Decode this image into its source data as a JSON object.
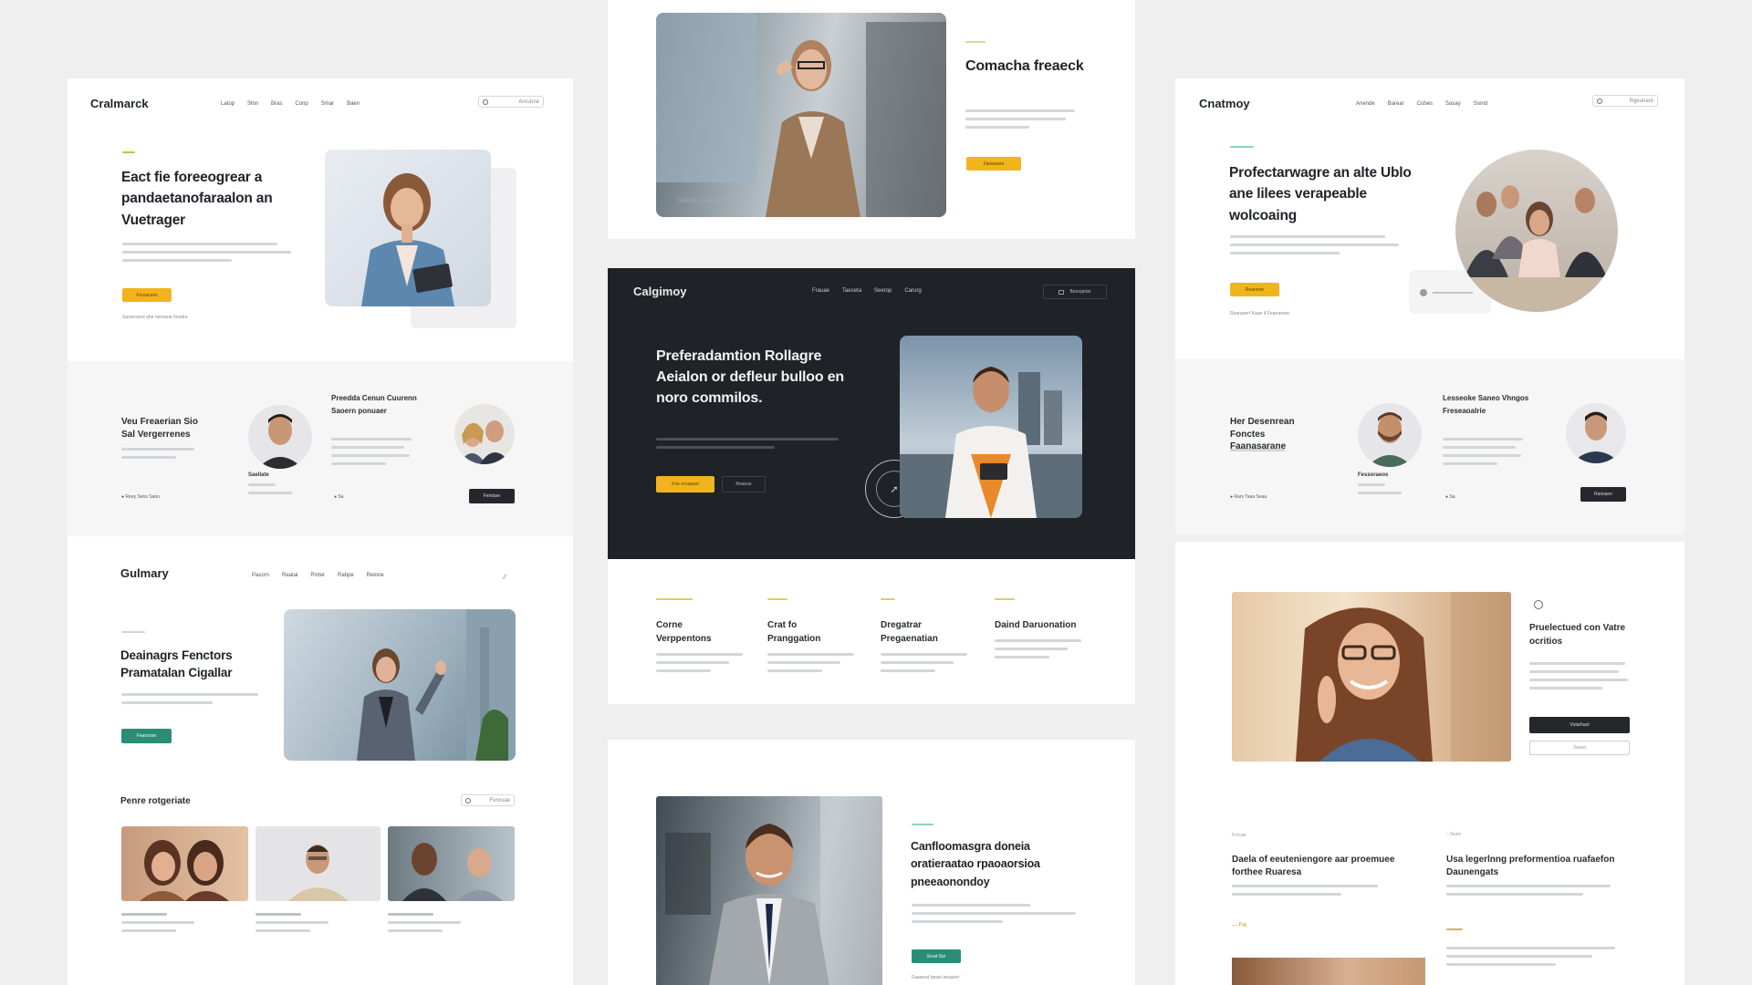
{
  "c1": {
    "logo": "Cralmarck",
    "nav": [
      "Latop",
      "Shin",
      "Bras",
      "Conp",
      "Smar",
      "Baen"
    ],
    "search": "Anrunne",
    "headline": "Eact fie foreeogrear a pandaetanofaraalon an Vuetrager",
    "cta": "Foreucess",
    "footnote": "Saoreranot ahe nerearar fonetre"
  },
  "c2": {
    "title": "Veu Freaerian Sio Sal Vergerrenes",
    "mid_heading": "Preedda Cenun Cuurenn Saoern ponuaer",
    "person_label": "Saellate",
    "meta_left": "Reey Sens Sanu",
    "meta_right": "Sa",
    "btn": "Fendare"
  },
  "c3": {
    "logo": "Gulmary",
    "nav": [
      "Pasorn",
      "Reatal",
      "Pinter",
      "Rabpe",
      "Relone"
    ],
    "headline": "Deainagrs Fenctors Pramatalan Cigallar",
    "cta": "Fearoone",
    "section": "Penre rotgeriate",
    "search": "Fenruae"
  },
  "m1": {
    "headline": "Comacha freaeck",
    "cta": "Fareseare",
    "caption": "TIREDD DAN AND"
  },
  "m2": {
    "logo": "Calgimoy",
    "nav": [
      "Frauae",
      "Taeseta",
      "Seerop",
      "Carurg"
    ],
    "btn_nav": "Banogetar",
    "headline": "Preferadamtion Rollagre Aeialon or defleur bulloo en noro commilos.",
    "cta1": "Frie ornaaset",
    "cta2": "Reanse"
  },
  "m3": {
    "features": [
      {
        "title": "Corne Verppentons"
      },
      {
        "title": "Crat fo Pranggation"
      },
      {
        "title": "Dregatrar Pregaenatian"
      },
      {
        "title": "Daind Daruonation"
      }
    ]
  },
  "m4": {
    "headline": "Canfloomasgra doneia oratieraatao rpaoaorsioa pneeaonondoy",
    "cta": "Srvat Sar",
    "footnote": "Faanesd tanse lenasetr"
  },
  "r1": {
    "logo": "Cnatmoy",
    "nav": [
      "Anende",
      "Barear",
      "Cobes",
      "Sasay",
      "Sonid"
    ],
    "search": "Rgeunare",
    "headline": "Profectarwagre an alte Ublo ane lilees verapeable wolcoaing",
    "cta": "Reanoon",
    "footnote": "Roanarerf Kaue 4 Fearneone"
  },
  "r2": {
    "title": "Her Desenrean Fonctes Faanasarane",
    "mid_heading": "Lesseoke Saneo Vhngos Freseaoalrie",
    "person_label": "Fessoraeos",
    "meta_left": "Rarv Taaa Seaa",
    "meta_right": "Sa",
    "btn": "Rarisaon"
  },
  "r3": {
    "heading": "Pruelectued con Vatre ocritios",
    "btn1": "Vutarhaol",
    "btn2": "Toseet",
    "tag_left": "Forcae",
    "tag_right": "Nuse",
    "col1_title": "Daela of eeuteniengore aar proemuee forthee Ruaresa",
    "col2_title": "Usa legerlnng preformentioa ruafaefon Daunengats",
    "col1_link": "Fte"
  },
  "colors": {
    "accent_yellow": "#f2b41c",
    "accent_teal": "#2c8d77",
    "dark_panel": "#1f2227"
  }
}
